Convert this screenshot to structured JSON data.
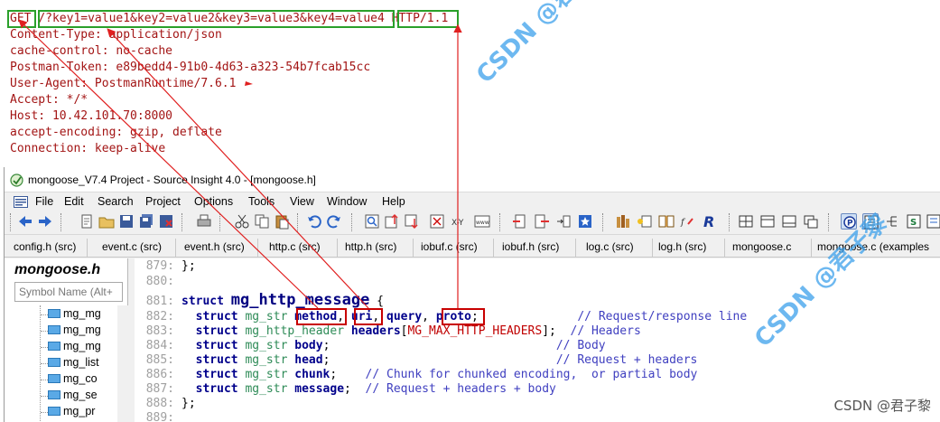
{
  "http_request": {
    "method": "GET",
    "uri": "/?key1=value1&key2=value2&key3=value3&key4=value4",
    "proto": "HTTP/1.1",
    "headers": [
      "Content-Type: application/json",
      "cache-control: no-cache",
      "Postman-Token: e89bedd4-91b0-4d63-a323-54b7fcab15cc",
      "User-Agent: PostmanRuntime/7.6.1",
      "Accept: */*",
      "Host: 10.42.101.70:8000",
      "accept-encoding: gzip, deflate",
      "Connection: keep-alive"
    ]
  },
  "window": {
    "title": "mongoose_V7.4 Project - Source Insight 4.0 - [mongoose.h]"
  },
  "menu": [
    "File",
    "Edit",
    "Search",
    "Project",
    "Options",
    "Tools",
    "View",
    "Window",
    "Help"
  ],
  "tabs": [
    "config.h (src)",
    "event.c (src)",
    "event.h (src)",
    "http.c (src)",
    "http.h (src)",
    "iobuf.c (src)",
    "iobuf.h (src)",
    "log.c (src)",
    "log.h (src)",
    "mongoose.c",
    "mongoose.c (examples"
  ],
  "sidebar": {
    "title": "mongoose.h",
    "search_placeholder": "Symbol Name (Alt+",
    "items": [
      "mg_mg",
      "mg_mg",
      "mg_mg",
      "mg_list",
      "mg_co",
      "mg_se",
      "mg_pr"
    ]
  },
  "code": {
    "line_numbers": [
      "879:",
      "880:",
      "881:",
      "882:",
      "883:",
      "884:",
      "885:",
      "886:",
      "887:",
      "888:",
      "889:"
    ],
    "l879": "};",
    "struct_kw": "struct",
    "struct_name": "mg_http_message",
    "brace_open": "{",
    "mg_str": "mg_str",
    "mg_http_header": "mg_http_header",
    "f_method": "method",
    "f_uri": "uri",
    "f_query": "query",
    "f_proto": "proto",
    "f_headers": "headers",
    "macro_max": "MG_MAX_HTTP_HEADERS",
    "f_body": "body",
    "f_head": "head",
    "f_chunk": "chunk",
    "f_message": "message",
    "c_request_line": "// Request/response line",
    "c_headers": "// Headers",
    "c_body": "// Body",
    "c_request_headers": "// Request + headers",
    "c_chunk": "// Chunk for chunked encoding,  or partial body",
    "c_message": "// Request + headers + body",
    "l888": "};"
  },
  "watermarks": {
    "top": "CSDN @君子黎",
    "bottom": "CSDN @君子黎",
    "credit": "CSDN @君子黎"
  },
  "colors": {
    "highlight_green": "#2aa02a",
    "highlight_red": "#c80000",
    "http_text": "#a31515",
    "watermark": "#3ca0eb"
  }
}
